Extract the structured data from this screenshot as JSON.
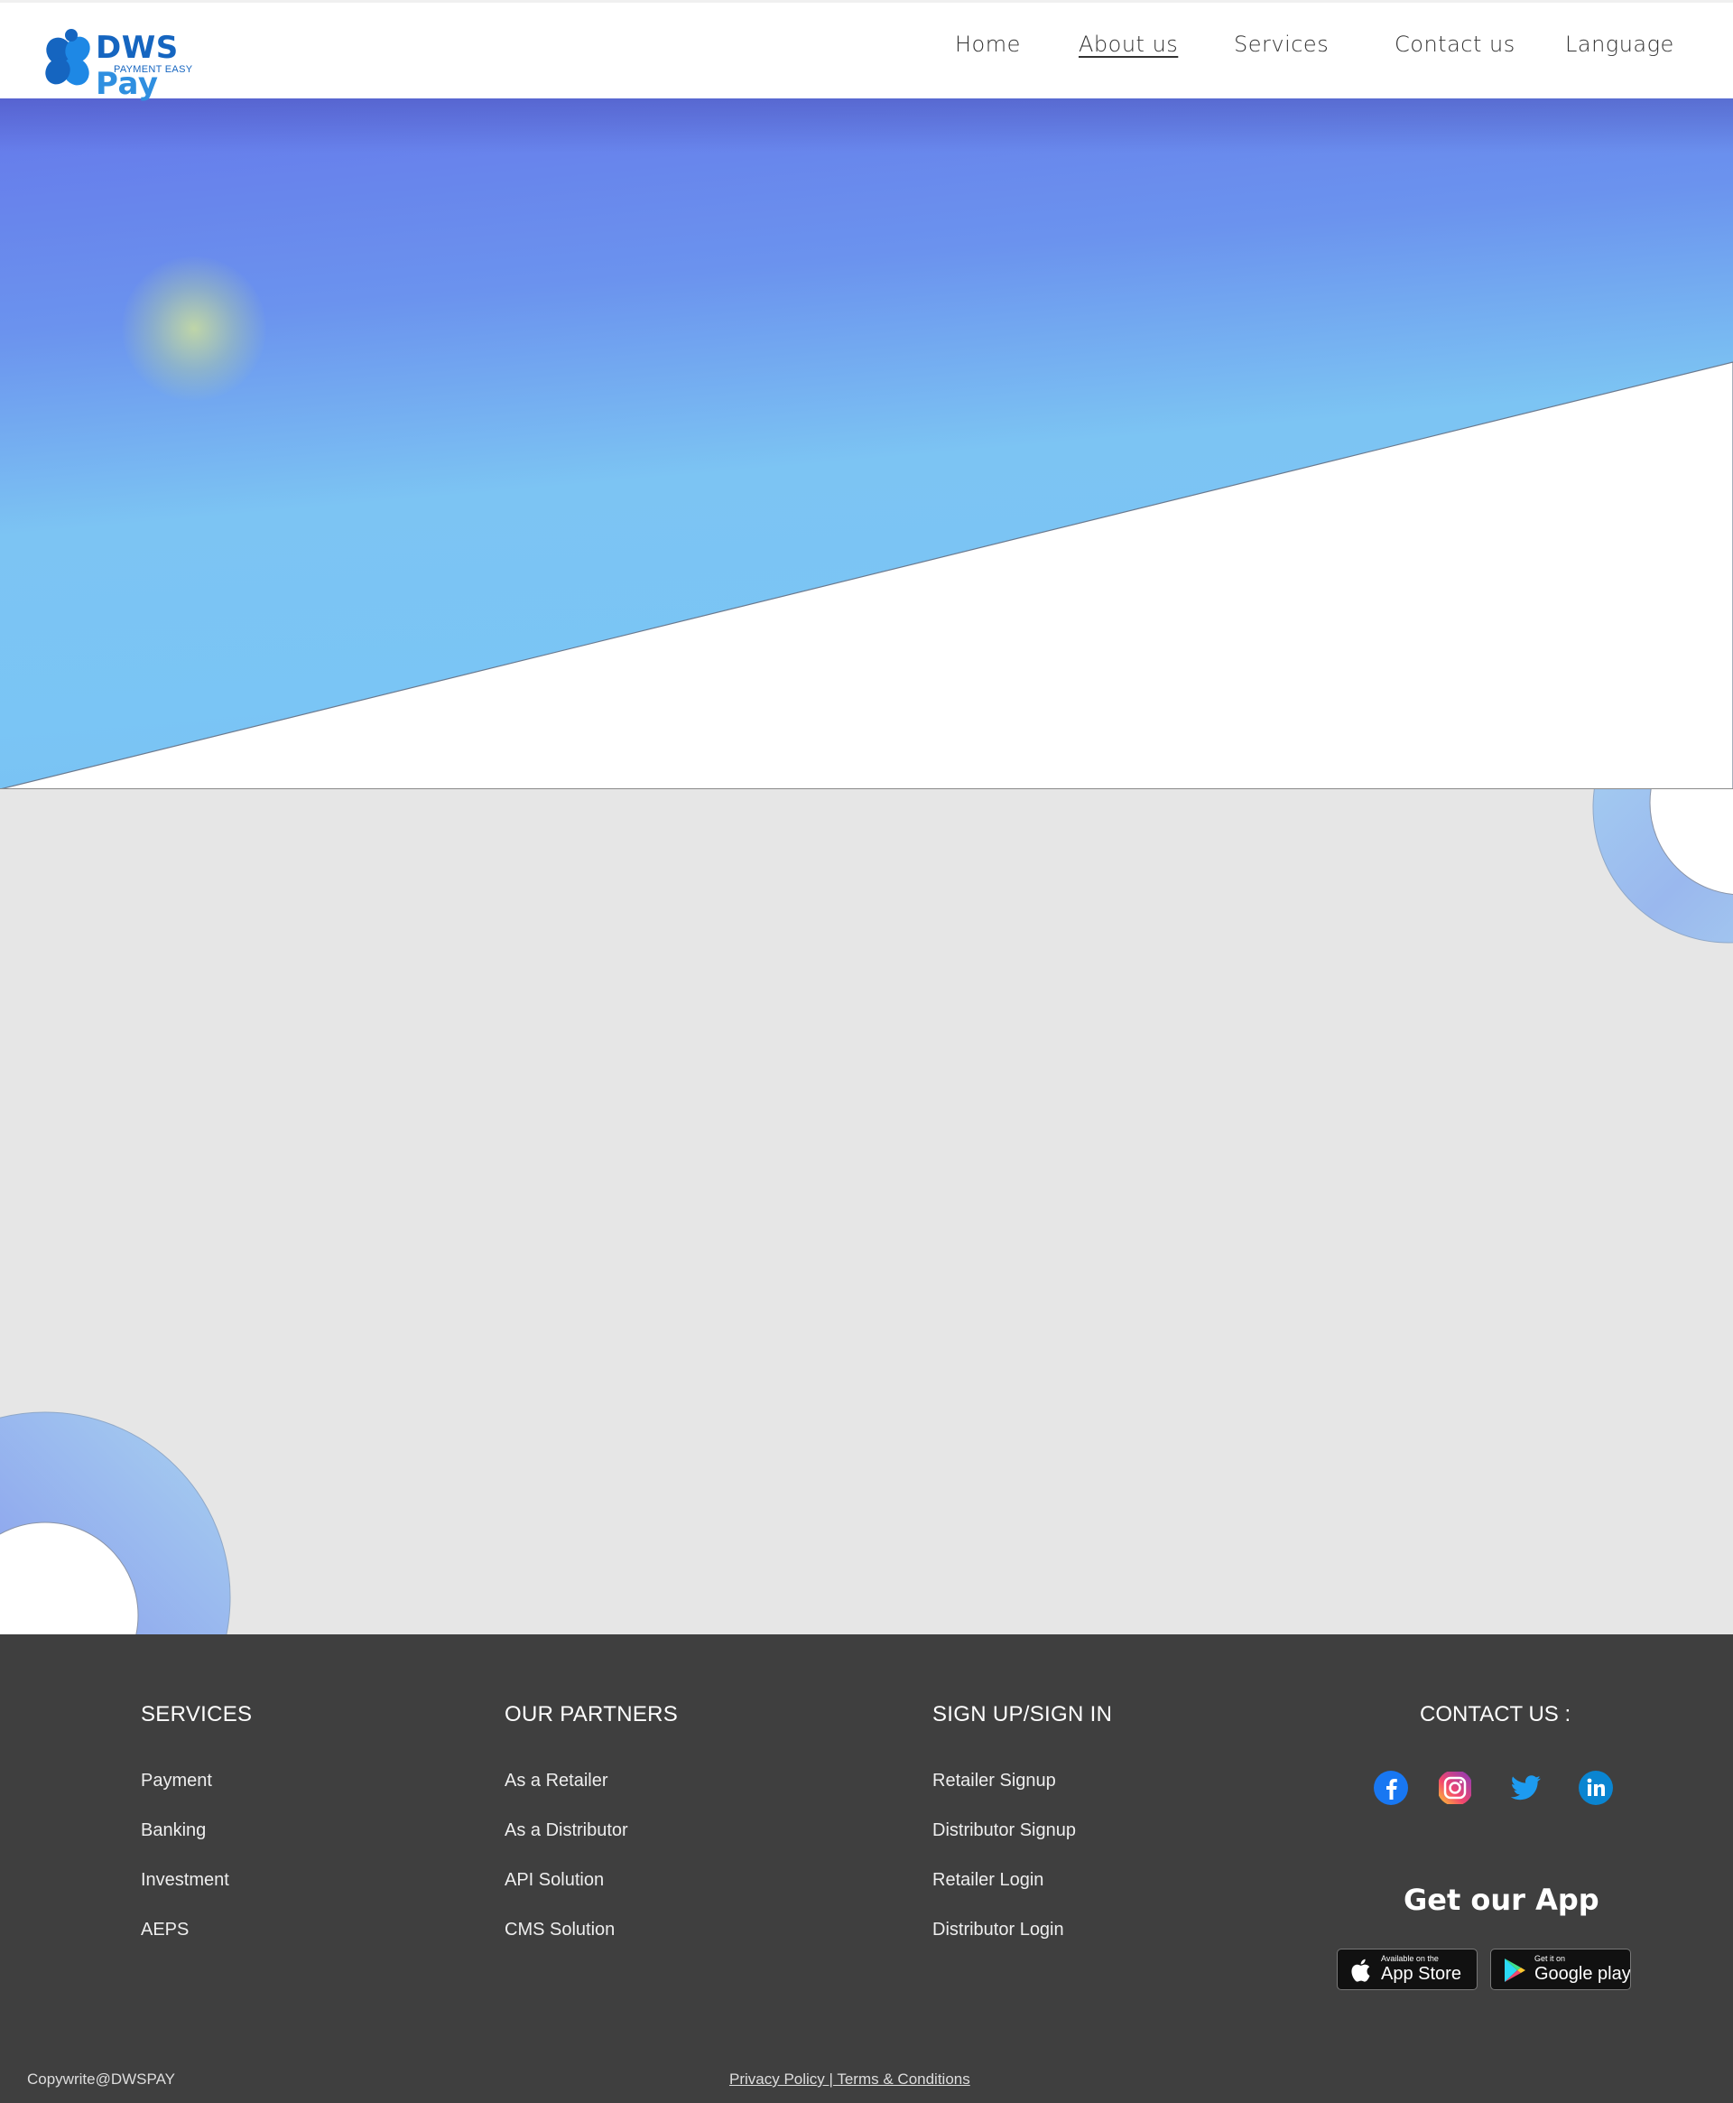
{
  "brand": {
    "name_part1": "DWS",
    "name_part2": "Pay",
    "tagline": "PAYMENT EASY"
  },
  "nav": {
    "items": [
      {
        "label": "Home",
        "active": false
      },
      {
        "label": "About us",
        "active": true
      },
      {
        "label": "Services",
        "active": false
      },
      {
        "label": "Contact us",
        "active": false
      },
      {
        "label": "Language",
        "active": false
      }
    ]
  },
  "footer": {
    "services": {
      "title": "SERVICES",
      "links": [
        "Payment",
        "Banking",
        "Investment",
        "AEPS"
      ]
    },
    "partners": {
      "title": "OUR PARTNERS",
      "links": [
        "As a Retailer",
        "As a Distributor",
        "API Solution",
        "CMS Solution"
      ]
    },
    "signup": {
      "title": "SIGN UP/SIGN IN",
      "links": [
        "Retailer Signup",
        "Distributor Signup",
        "Retailer Login",
        "Distributor Login"
      ]
    },
    "contact": {
      "title": "CONTACT US :",
      "social": [
        "facebook-icon",
        "instagram-icon",
        "twitter-icon",
        "linkedin-icon"
      ]
    },
    "app": {
      "title": "Get our App",
      "app_store_small": "Available on the",
      "app_store_big": "App Store",
      "play_small": "Get it on",
      "play_big": "Google play"
    },
    "copyright": "Copywrite@DWSPAY",
    "legal": "Privacy Policy | Terms & Conditions"
  },
  "colors": {
    "brand_dark": "#1565c0",
    "brand_light": "#2f8fe0",
    "footer_bg": "#3f3f3f",
    "content_bg": "#e6e6e6"
  }
}
